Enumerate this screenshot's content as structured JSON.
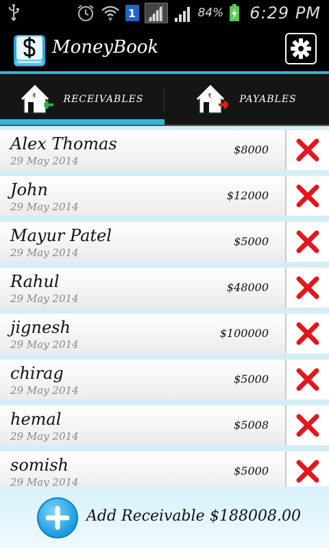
{
  "status_bar": {
    "battery_percent": "84%",
    "time": "6:29 PM",
    "sim_label": "1"
  },
  "app": {
    "title": "MoneyBook",
    "accent_color": "#33b5e5"
  },
  "tabs": [
    {
      "label": "RECEIVABLES",
      "selected": true,
      "icon": "house-arrow-in-icon"
    },
    {
      "label": "PAYABLES",
      "selected": false,
      "icon": "house-arrow-out-icon"
    }
  ],
  "entries": [
    {
      "name": "Alex Thomas",
      "date": "29 May 2014",
      "amount": "$8000"
    },
    {
      "name": "John",
      "date": "29 May 2014",
      "amount": "$12000"
    },
    {
      "name": "Mayur Patel",
      "date": "29 May 2014",
      "amount": "$5000"
    },
    {
      "name": "Rahul",
      "date": "29 May 2014",
      "amount": "$48000"
    },
    {
      "name": "jignesh",
      "date": "29 May 2014",
      "amount": "$100000"
    },
    {
      "name": "chirag",
      "date": "29 May 2014",
      "amount": "$5000"
    },
    {
      "name": "hemal",
      "date": "29 May 2014",
      "amount": "$5008"
    },
    {
      "name": "somish",
      "date": "29 May 2014",
      "amount": "$5000"
    }
  ],
  "footer": {
    "add_label": "Add Receivable",
    "total": "$188008.00"
  }
}
